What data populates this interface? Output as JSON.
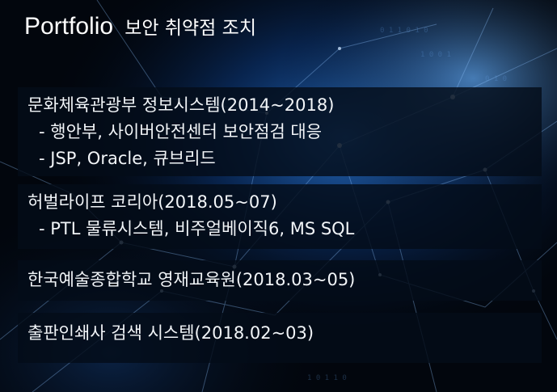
{
  "title": {
    "en": "Portfolio",
    "ko": "보안 취약점 조치"
  },
  "projects": [
    {
      "heading": "문화체육관광부 정보시스템(2014~2018)",
      "details": [
        "- 행안부, 사이버안전센터 보안점검 대응",
        "- JSP, Oracle, 큐브리드"
      ]
    },
    {
      "heading": "허벌라이프 코리아(2018.05~07)",
      "details": [
        "- PTL 물류시스템, 비주얼베이직6, MS SQL"
      ]
    },
    {
      "heading": "한국예술종합학교 영재교육원(2018.03~05)",
      "details": []
    },
    {
      "heading": "출판인쇄사 검색 시스템(2018.02~03)",
      "details": []
    }
  ],
  "colors": {
    "background": "#02060d",
    "accent_blue": "#1e6fd6",
    "text": "#ffffff"
  }
}
